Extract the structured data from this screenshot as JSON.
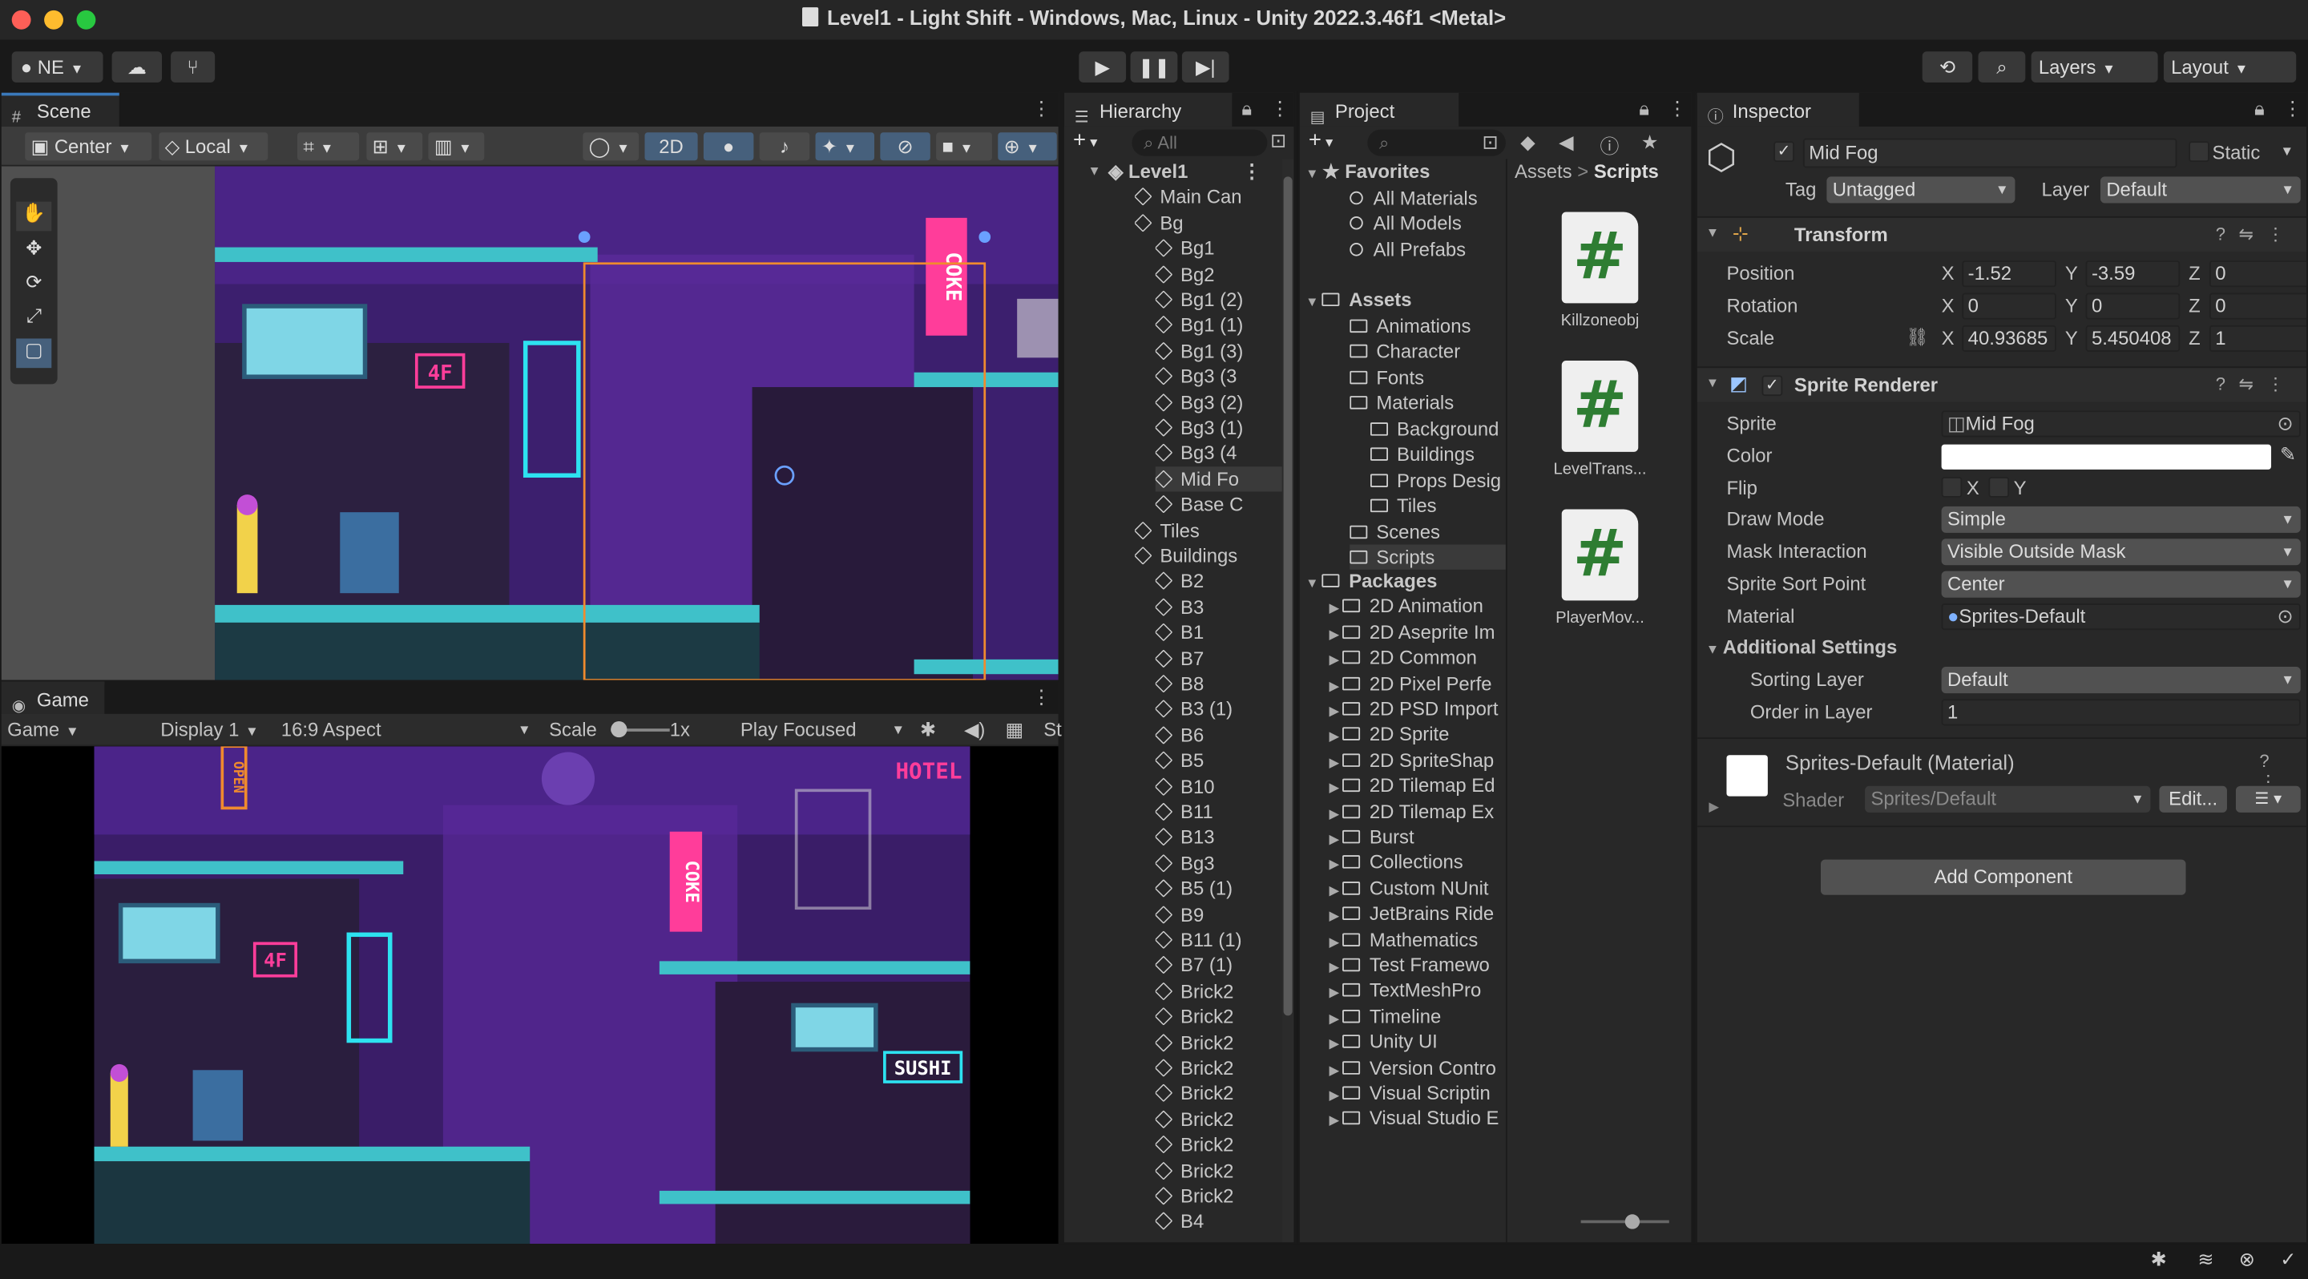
{
  "window": {
    "title": "Level1 - Light Shift - Windows, Mac, Linux - Unity 2022.3.46f1 <Metal>",
    "traffic_colors": [
      "#fe5f57",
      "#febc2e",
      "#28c840"
    ]
  },
  "toolbar": {
    "account": "NE",
    "layers": "Layers",
    "layout": "Layout"
  },
  "scene": {
    "tab": "Scene",
    "pivot": "Center",
    "space": "Local",
    "mode_2d": "2D"
  },
  "game": {
    "tab": "Game",
    "view": "Game",
    "display": "Display 1",
    "aspect": "16:9 Aspect",
    "scale_label": "Scale",
    "scale_value": "1x",
    "play_mode": "Play Focused",
    "stats": "St"
  },
  "scene_art": {
    "signs": [
      "OPEN",
      "HOTEL",
      "SUSHI",
      "COKE",
      "4F"
    ]
  },
  "hierarchy": {
    "tab": "Hierarchy",
    "search_placeholder": "All",
    "scene_name": "Level1",
    "items": [
      "Main Can",
      "Bg",
      "Bg1",
      "Bg2",
      "Bg1 (2)",
      "Bg1 (1)",
      "Bg1 (3)",
      "Bg3 (3",
      "Bg3 (2)",
      "Bg3 (1)",
      "Bg3 (4",
      "Mid Fo",
      "Base C",
      "Tiles",
      "Buildings",
      "B2",
      "B3",
      "B1",
      "B7",
      "B8",
      "B3 (1)",
      "B6",
      "B5",
      "B10",
      "B11",
      "B13",
      "Bg3",
      "B5 (1)",
      "B9",
      "B11 (1)",
      "B7 (1)",
      "Brick2",
      "Brick2",
      "Brick2",
      "Brick2",
      "Brick2",
      "Brick2",
      "Brick2",
      "Brick2",
      "Brick2",
      "B4"
    ]
  },
  "project": {
    "tab": "Project",
    "favorites_label": "Favorites",
    "favorites": [
      "All Materials",
      "All Models",
      "All Prefabs"
    ],
    "assets_label": "Assets",
    "assets": [
      "Animations",
      "Character",
      "Fonts",
      "Materials",
      "Background",
      "Buildings",
      "Props Desig",
      "Tiles",
      "Scenes",
      "Scripts"
    ],
    "packages_label": "Packages",
    "packages": [
      "2D Animation",
      "2D Aseprite Im",
      "2D Common",
      "2D Pixel Perfe",
      "2D PSD Import",
      "2D Sprite",
      "2D SpriteShap",
      "2D Tilemap Ed",
      "2D Tilemap Ex",
      "Burst",
      "Collections",
      "Custom NUnit",
      "JetBrains Ride",
      "Mathematics",
      "Test Framewo",
      "TextMeshPro",
      "Timeline",
      "Unity UI",
      "Version Contro",
      "Visual Scriptin",
      "Visual Studio E"
    ],
    "breadcrumb_root": "Assets",
    "breadcrumb_current": "Scripts",
    "scripts": [
      "Killzoneobj",
      "LevelTrans...",
      "PlayerMov..."
    ],
    "script_glyph": "#"
  },
  "inspector": {
    "tab": "Inspector",
    "object_name": "Mid Fog",
    "static_label": "Static",
    "tag_label": "Tag",
    "tag_value": "Untagged",
    "layer_label": "Layer",
    "layer_value": "Default",
    "transform": {
      "title": "Transform",
      "position_label": "Position",
      "rotation_label": "Rotation",
      "scale_label": "Scale",
      "position": [
        "-1.52",
        "-3.59",
        "0"
      ],
      "rotation": [
        "0",
        "0",
        "0"
      ],
      "scale": [
        "40.93685",
        "5.450408",
        "1"
      ]
    },
    "sprite_renderer": {
      "title": "Sprite Renderer",
      "sprite_label": "Sprite",
      "sprite_value": "Mid Fog",
      "color_label": "Color",
      "flip_label": "Flip",
      "draw_mode_label": "Draw Mode",
      "draw_mode": "Simple",
      "mask_label": "Mask Interaction",
      "mask": "Visible Outside Mask",
      "sort_point_label": "Sprite Sort Point",
      "sort_point": "Center",
      "material_label": "Material",
      "material": "Sprites-Default",
      "additional": "Additional Settings",
      "sorting_layer_label": "Sorting Layer",
      "sorting_layer": "Default",
      "order_label": "Order in Layer",
      "order": "1"
    },
    "material_block": {
      "name": "Sprites-Default (Material)",
      "shader_label": "Shader",
      "shader": "Sprites/Default",
      "edit": "Edit..."
    },
    "add_component": "Add Component"
  },
  "axis": {
    "x": "X",
    "y": "Y",
    "z": "Z"
  },
  "colors": {
    "accent": "#3a79bb",
    "panel": "#282828",
    "neon_pink": "#ff3d9a",
    "neon_cyan": "#2de2f0",
    "sky_purple": "#5a2a9a"
  }
}
